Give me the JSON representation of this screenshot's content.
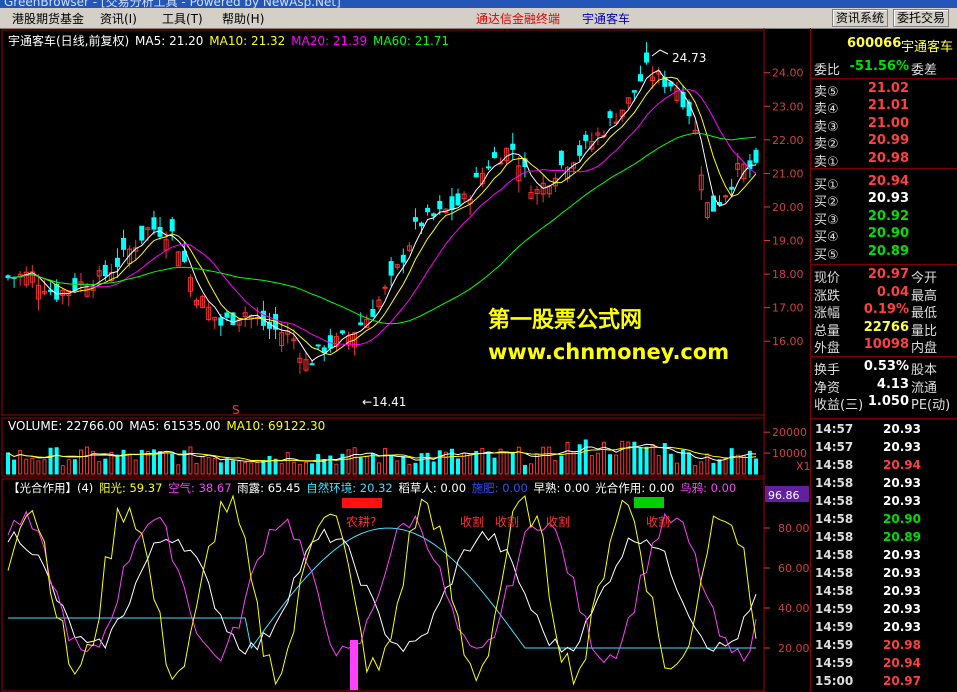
{
  "window": {
    "title": "GreenBrowser - [交易分析工具 - Powered by NewAsp.Net]"
  },
  "menu": {
    "items": [
      "港股期货基金",
      "资讯(I)",
      "工具(T)",
      "帮助(H)"
    ],
    "ad1": "通达信金融终端",
    "ad2": "宇通客车",
    "btn1": "资讯系统",
    "btn2": "委托交易"
  },
  "kline": {
    "title": "宇通客车(日线,前复权)",
    "ma5": "MA5: 21.20",
    "ma10": "MA10: 21.32",
    "ma20": "MA20: 21.39",
    "ma60": "MA60: 21.71",
    "high_label": "24.73",
    "low_label": "14.41",
    "signal": "S",
    "yticks": [
      "24.00",
      "23.00",
      "22.00",
      "21.00",
      "20.00",
      "19.00",
      "18.00",
      "17.00",
      "16.00"
    ]
  },
  "volume": {
    "title": "VOLUME: 22766.00",
    "ma5": "MA5: 61535.00",
    "ma10": "MA10: 69122.30",
    "yticks": [
      "20000",
      "10000"
    ],
    "unit": "X10"
  },
  "indicator": {
    "title": "【光合作用】(4)",
    "yang": "阳光: 59.37",
    "kong": "空气: 38.67",
    "yu": "雨露: 65.45",
    "ziran": "自然环境: 20.32",
    "dao": "稻草人: 0.00",
    "fa": "施肥: 0.00",
    "zao": "早熟: 0.00",
    "gh": "光合作用: 0.00",
    "niao": "鸟鸦: 0.00",
    "current": "96.86",
    "yticks": [
      "80.00",
      "60.00",
      "40.00",
      "20.00"
    ],
    "notes": [
      "农耕?",
      "收割",
      "收割",
      "收割",
      "收割"
    ]
  },
  "watermark": {
    "line1": "第一股票公式网",
    "line2": "www.chnmoney.com"
  },
  "panel": {
    "code": "600066",
    "name": "宇通客车",
    "weibi": {
      "l": "委比",
      "v": "-51.56%",
      "r": "委差"
    },
    "sells": [
      {
        "l": "卖⑤",
        "v": "21.02"
      },
      {
        "l": "卖④",
        "v": "21.01"
      },
      {
        "l": "卖③",
        "v": "21.00"
      },
      {
        "l": "卖②",
        "v": "20.99"
      },
      {
        "l": "卖①",
        "v": "20.98"
      }
    ],
    "buys": [
      {
        "l": "买①",
        "v": "20.94",
        "c": "red"
      },
      {
        "l": "买②",
        "v": "20.93",
        "c": "wht"
      },
      {
        "l": "买③",
        "v": "20.92",
        "c": "grn"
      },
      {
        "l": "买④",
        "v": "20.90",
        "c": "grn"
      },
      {
        "l": "买⑤",
        "v": "20.89",
        "c": "grn"
      }
    ],
    "stats": [
      {
        "l": "现价",
        "v": "20.97",
        "r": "今开",
        "c": "red"
      },
      {
        "l": "涨跌",
        "v": "0.04",
        "r": "最高",
        "c": "red"
      },
      {
        "l": "涨幅",
        "v": "0.19%",
        "r": "最低",
        "c": "red"
      },
      {
        "l": "总量",
        "v": "22766",
        "r": "量比",
        "c": "yel"
      },
      {
        "l": "外盘",
        "v": "10098",
        "r": "内盘",
        "c": "red"
      }
    ],
    "stats2": [
      {
        "l": "换手",
        "v": "0.53%",
        "r": "股本",
        "c": "wht"
      },
      {
        "l": "净资",
        "v": "4.13",
        "r": "流通",
        "c": "wht"
      },
      {
        "l": "收益(三)",
        "v": "1.050",
        "r": "PE(动)",
        "c": "wht"
      }
    ],
    "ticks": [
      {
        "t": "14:57",
        "p": "20.93",
        "c": "wht"
      },
      {
        "t": "14:57",
        "p": "20.93",
        "c": "wht"
      },
      {
        "t": "14:58",
        "p": "20.94",
        "c": "red"
      },
      {
        "t": "14:58",
        "p": "20.93",
        "c": "wht"
      },
      {
        "t": "14:58",
        "p": "20.93",
        "c": "wht"
      },
      {
        "t": "14:58",
        "p": "20.90",
        "c": "grn"
      },
      {
        "t": "14:58",
        "p": "20.89",
        "c": "grn"
      },
      {
        "t": "14:58",
        "p": "20.93",
        "c": "wht"
      },
      {
        "t": "14:58",
        "p": "20.93",
        "c": "wht"
      },
      {
        "t": "14:58",
        "p": "20.93",
        "c": "wht"
      },
      {
        "t": "14:59",
        "p": "20.93",
        "c": "wht"
      },
      {
        "t": "14:59",
        "p": "20.93",
        "c": "wht"
      },
      {
        "t": "14:59",
        "p": "20.98",
        "c": "red"
      },
      {
        "t": "14:59",
        "p": "20.94",
        "c": "red"
      },
      {
        "t": "15:00",
        "p": "20.97",
        "c": "red"
      }
    ]
  },
  "colors": {
    "up": "#ff3030",
    "down": "#00ffff",
    "ma5": "#ffffff",
    "ma10": "#ffff00",
    "ma20": "#ff00ff",
    "ma60": "#00ff00"
  }
}
